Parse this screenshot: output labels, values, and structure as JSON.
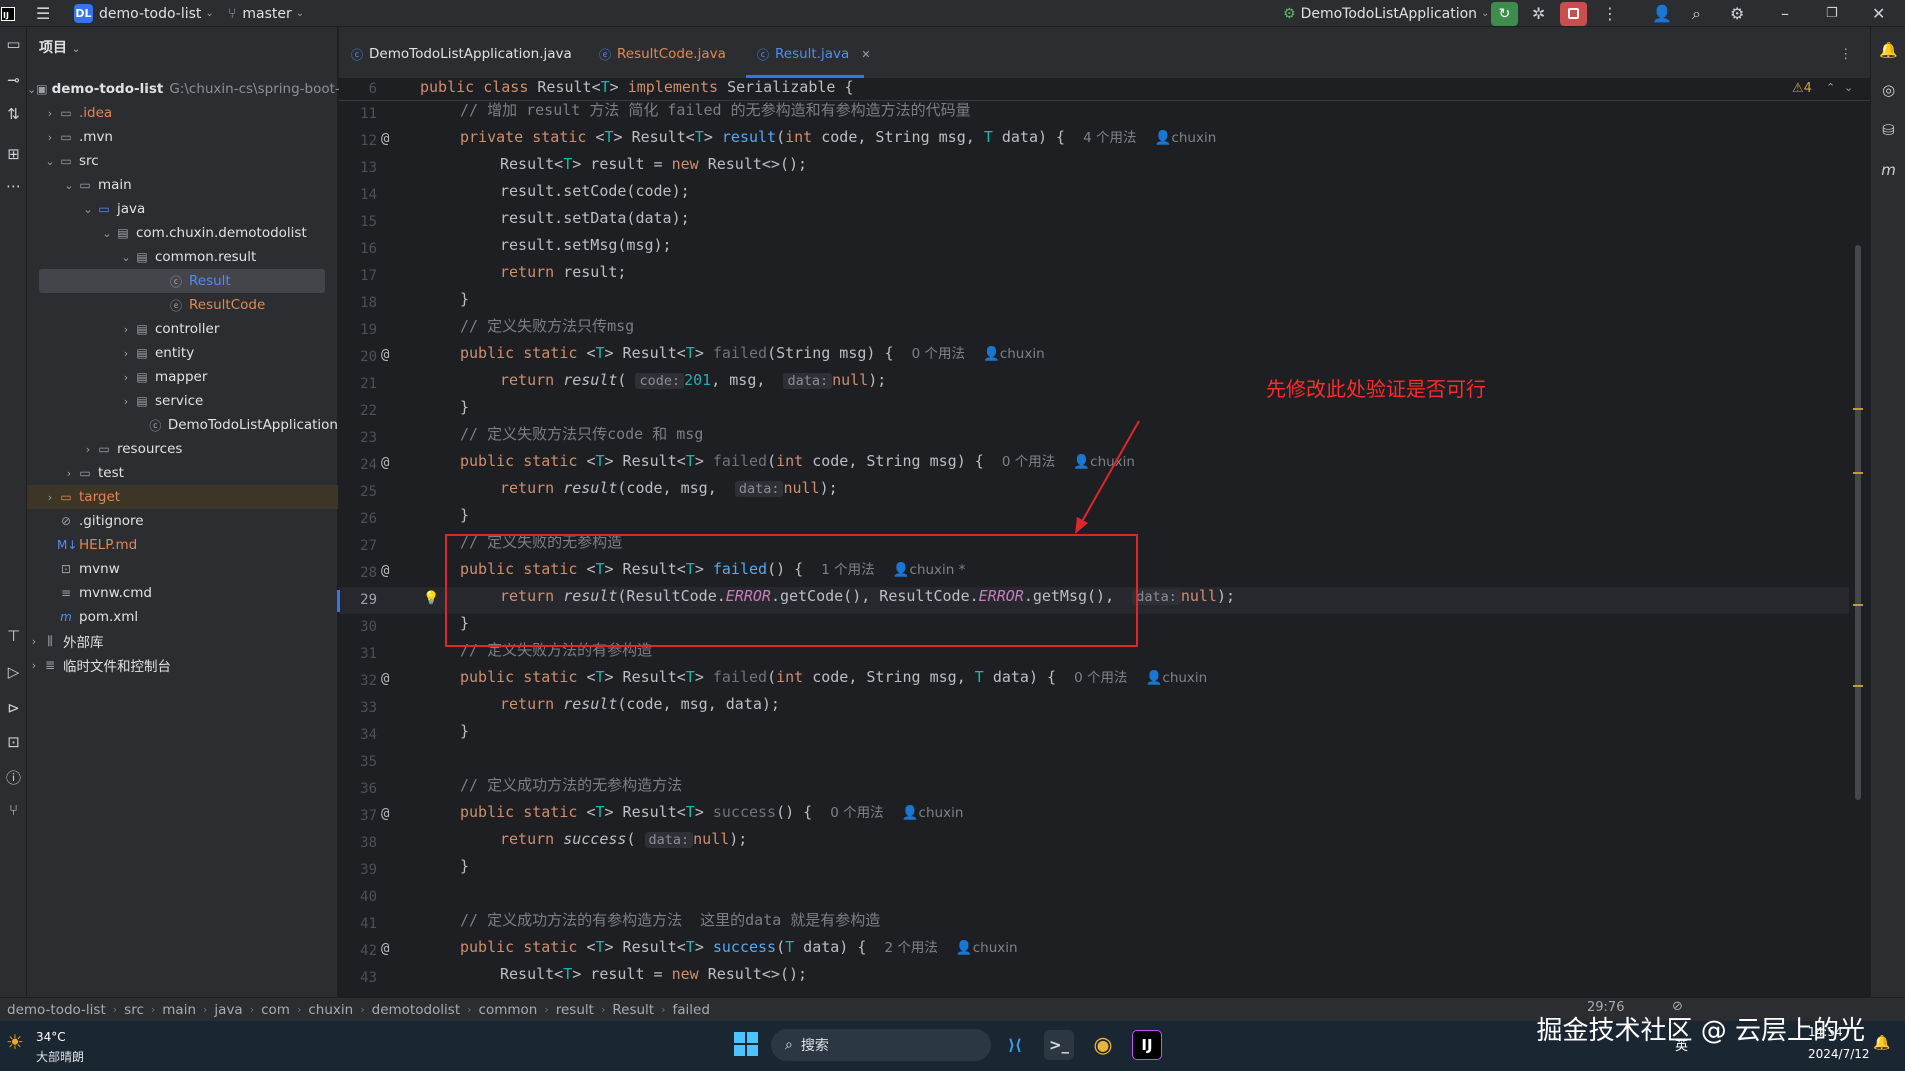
{
  "titlebar": {
    "project_badge": "DL",
    "project_name": "demo-todo-list",
    "branch": "master",
    "run_config": "DemoTodoListApplication"
  },
  "project_panel": {
    "header": "项目",
    "root_name": "demo-todo-list",
    "root_path": "G:\\chuxin-cs\\spring-boot-",
    "items": [
      {
        "label": ".idea"
      },
      {
        "label": ".mvn"
      },
      {
        "label": "src"
      },
      {
        "label": "main"
      },
      {
        "label": "java"
      },
      {
        "label": "com.chuxin.demotodolist"
      },
      {
        "label": "common.result"
      },
      {
        "label": "Result"
      },
      {
        "label": "ResultCode"
      },
      {
        "label": "controller"
      },
      {
        "label": "entity"
      },
      {
        "label": "mapper"
      },
      {
        "label": "service"
      },
      {
        "label": "DemoTodoListApplication"
      },
      {
        "label": "resources"
      },
      {
        "label": "test"
      },
      {
        "label": "target"
      },
      {
        "label": ".gitignore"
      },
      {
        "label": "HELP.md"
      },
      {
        "label": "mvnw"
      },
      {
        "label": "mvnw.cmd"
      },
      {
        "label": "pom.xml"
      },
      {
        "label": "外部库"
      },
      {
        "label": "临时文件和控制台"
      }
    ]
  },
  "tabs": [
    {
      "label": "DemoTodoListApplication.java"
    },
    {
      "label": "ResultCode.java"
    },
    {
      "label": "Result.java"
    }
  ],
  "sticky": {
    "line": "6",
    "warnings": "4"
  },
  "editor": {
    "lines": [
      "11",
      "12",
      "13",
      "14",
      "15",
      "16",
      "17",
      "18",
      "19",
      "20",
      "21",
      "22",
      "23",
      "24",
      "25",
      "26",
      "27",
      "28",
      "29",
      "30",
      "31",
      "32",
      "33",
      "34",
      "35",
      "36",
      "37",
      "38",
      "39",
      "40",
      "41",
      "42",
      "43"
    ],
    "comment_11": "// 增加 result 方法 简化 failed 的无参构造和有参构造方法的代码量",
    "comment_19": "// 定义失败方法只传msg",
    "comment_23": "// 定义失败方法只传code 和 msg",
    "comment_27": "// 定义失败的无参构造",
    "comment_31": "// 定义失败方法的有参构造",
    "comment_36": "// 定义成功方法的无参构造方法",
    "comment_41": "// 定义成功方法的有参构造方法  这里的data 就是有参构造",
    "usage_4": "4 个用法",
    "usage_0": "0 个用法",
    "usage_1": "1 个用法",
    "usage_2": "2 个用法",
    "author": "chuxin",
    "author_mod": "chuxin *",
    "hint_code": "code:",
    "hint_data": "data:",
    "annotation": "先修改此处验证是否可行"
  },
  "breadcrumb": [
    "demo-todo-list",
    "src",
    "main",
    "java",
    "com",
    "chuxin",
    "demotodolist",
    "common",
    "result",
    "Result",
    "failed"
  ],
  "status": {
    "position": "29:76"
  },
  "taskbar": {
    "weather_temp": "34°C",
    "weather_desc": "大部晴朗",
    "search_label": "搜索",
    "time": "14:54",
    "date": "2024/7/12",
    "ime": "英"
  },
  "watermark": "掘金技术社区 @ 云层上的光",
  "colors": {
    "accent": "#3574f0",
    "annotation": "#e0262a"
  }
}
